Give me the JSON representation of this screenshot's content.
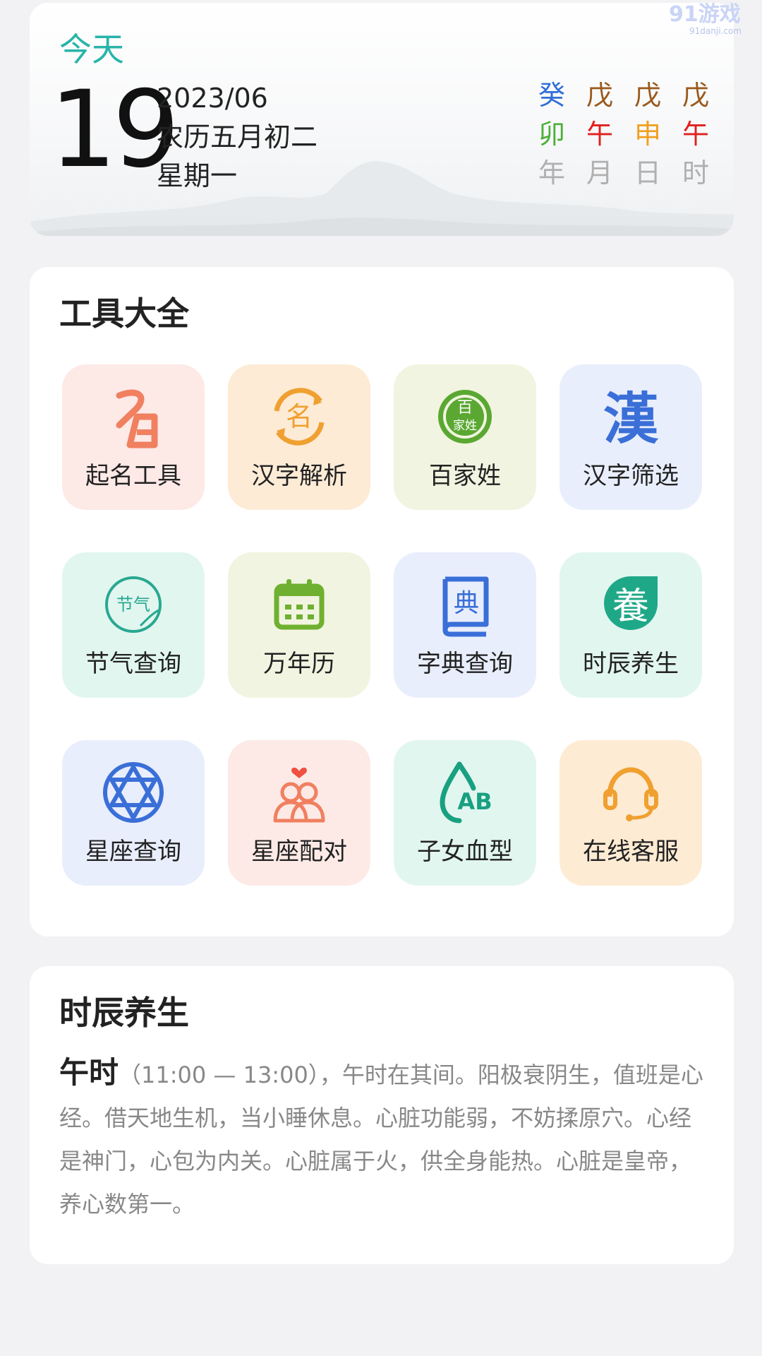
{
  "today": {
    "label": "今天",
    "day": "19",
    "year_month": "2023/06",
    "lunar": "农历五月初二",
    "weekday": "星期一",
    "ganzhi": [
      {
        "stem": "癸",
        "branch": "卯",
        "label": "年",
        "stem_color": "#2f6fd8",
        "branch_color": "#4caf38"
      },
      {
        "stem": "戊",
        "branch": "午",
        "label": "月",
        "stem_color": "#9a5a1c",
        "branch_color": "#e02020"
      },
      {
        "stem": "戊",
        "branch": "申",
        "label": "日",
        "stem_color": "#9a5a1c",
        "branch_color": "#f0a020"
      },
      {
        "stem": "戊",
        "branch": "午",
        "label": "时",
        "stem_color": "#9a5a1c",
        "branch_color": "#e02020"
      }
    ]
  },
  "tools": {
    "title": "工具大全",
    "items": [
      {
        "label": "起名工具",
        "icon": "naming-icon"
      },
      {
        "label": "汉字解析",
        "icon": "char-analysis-icon"
      },
      {
        "label": "百家姓",
        "icon": "surname-icon"
      },
      {
        "label": "汉字筛选",
        "icon": "char-filter-icon"
      },
      {
        "label": "节气查询",
        "icon": "solar-term-icon"
      },
      {
        "label": "万年历",
        "icon": "calendar-icon"
      },
      {
        "label": "字典查询",
        "icon": "dictionary-icon"
      },
      {
        "label": "时辰养生",
        "icon": "wellness-icon"
      },
      {
        "label": "星座查询",
        "icon": "hexagram-star-icon"
      },
      {
        "label": "星座配对",
        "icon": "couple-icon"
      },
      {
        "label": "子女血型",
        "icon": "blood-drop-icon"
      },
      {
        "label": "在线客服",
        "icon": "headset-icon"
      }
    ],
    "icon_text": {
      "naming": "名",
      "surname_top": "百",
      "surname_bottom": "家姓",
      "filter": "漢",
      "solar_term": "节气",
      "dictionary": "典",
      "wellness": "養",
      "blood": "AB"
    }
  },
  "health": {
    "title": "时辰养生",
    "hour_name": "午时",
    "hour_range": "（11:00 — 13:00），",
    "text": "午时在其间。阳极衰阴生，值班是心经。借天地生机，当小睡休息。心脏功能弱，不妨揉原穴。心经是神门，心包为内关。心脏属于火，供全身能热。心脏是皇帝，养心数第一。"
  },
  "watermark": {
    "main": "91游戏",
    "sub": "91danji.com"
  }
}
